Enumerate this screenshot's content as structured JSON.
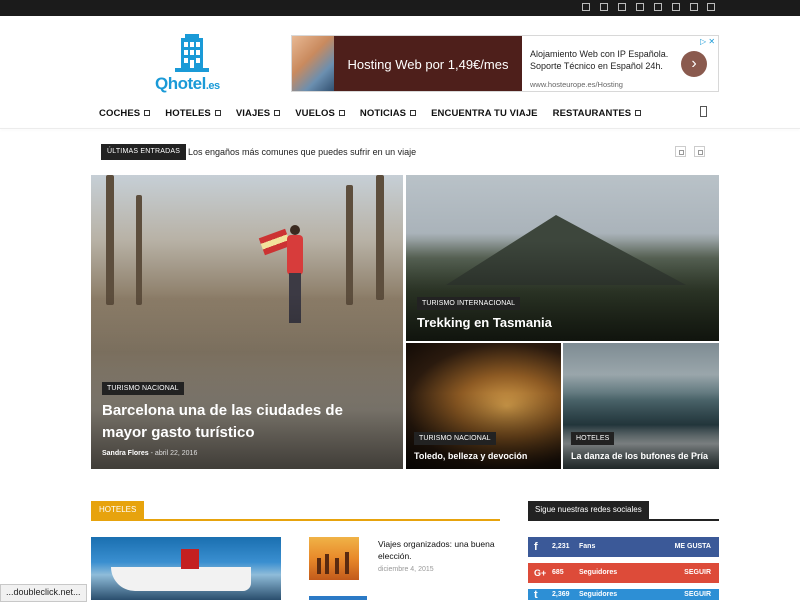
{
  "site": {
    "logo_text": "Qhotel",
    "logo_suffix": ".es",
    "brand_color": "#1a9ad7"
  },
  "topbar": {
    "social_icons": [
      "icon-1",
      "icon-2",
      "icon-3",
      "icon-4",
      "icon-5",
      "icon-6",
      "icon-7",
      "icon-8"
    ]
  },
  "ad": {
    "headline": "Hosting Web por 1,49€/mes",
    "copy_line1": "Alojamiento Web con IP Española.",
    "copy_line2": "Soporte Técnico en Español 24h.",
    "url": "www.hosteurope.es/Hosting",
    "adchoices": "▷ ✕",
    "arrow": "›"
  },
  "nav": {
    "items": [
      {
        "label": "COCHES",
        "dropdown": true
      },
      {
        "label": "HOTELES",
        "dropdown": true
      },
      {
        "label": "VIAJES",
        "dropdown": true
      },
      {
        "label": "VUELOS",
        "dropdown": true
      },
      {
        "label": "NOTICIAS",
        "dropdown": true
      },
      {
        "label": "ENCUENTRA TU VIAJE",
        "dropdown": false
      },
      {
        "label": "RESTAURANTES",
        "dropdown": true
      }
    ]
  },
  "ticker": {
    "label": "ÚLTIMAS ENTRADAS",
    "text": "Los engaños más comunes que puedes sufrir en un viaje"
  },
  "featured": {
    "main": {
      "category": "TURISMO NACIONAL",
      "title_line1": "Barcelona una de las ciudades de",
      "title_line2": "mayor gasto turístico",
      "author": "Sandra Flores",
      "date": "abril 22, 2016"
    },
    "tasmania": {
      "category": "TURISMO INTERNACIONAL",
      "title": "Trekking en Tasmania"
    },
    "toledo": {
      "category": "TURISMO NACIONAL",
      "title": "Toledo, belleza y devoción"
    },
    "pria": {
      "category": "HOTELES",
      "title": "La danza de los bufones de Pría"
    }
  },
  "sections": {
    "hoteles_label": "HOTELES",
    "redes_label": "Sigue nuestras redes sociales"
  },
  "articles": [
    {
      "title_line1": "Viajes organizados: una buena",
      "title_line2": "elección.",
      "date": "diciembre 4, 2015"
    }
  ],
  "social": {
    "facebook": {
      "icon": "f",
      "count": "2,231",
      "label": "Fans",
      "action": "ME GUSTA",
      "color": "#3b5998"
    },
    "googleplus": {
      "icon": "G+",
      "count": "685",
      "label": "Seguidores",
      "action": "SEGUIR",
      "color": "#dd4b39"
    },
    "twitter": {
      "icon": "t",
      "count": "2,369",
      "label": "Seguidores",
      "action": "SEGUIR",
      "color": "#2d8fd5"
    }
  },
  "statusbar": {
    "text": "...doubleclick.net..."
  }
}
